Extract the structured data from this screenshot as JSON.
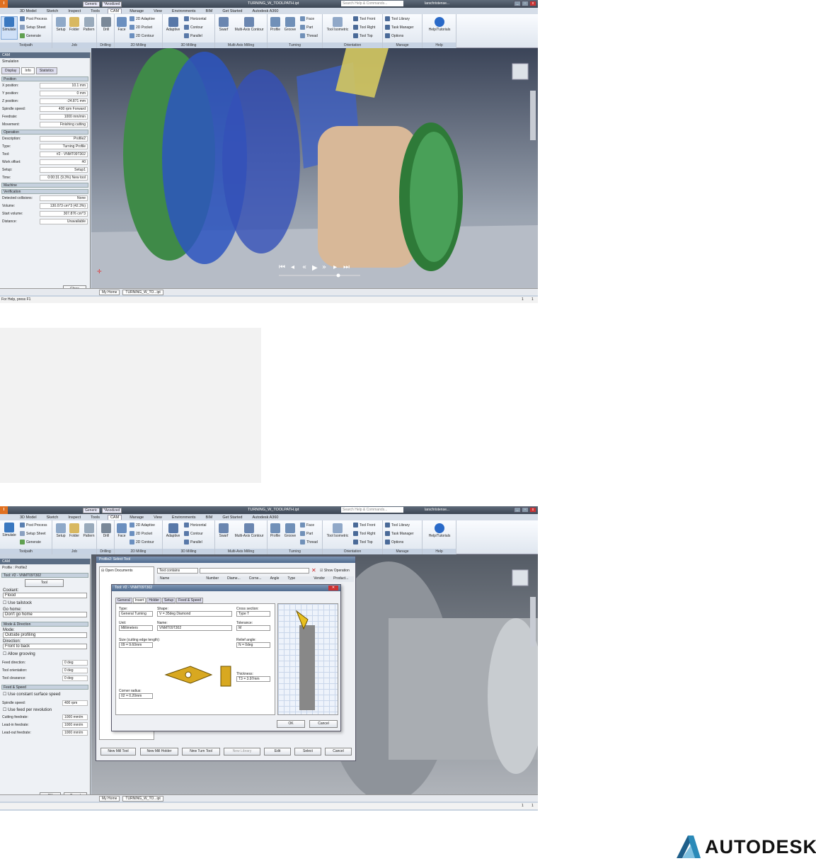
{
  "qat": {
    "app_letter": "I",
    "style_combo": "Generic",
    "material_combo": "*Anodized",
    "title": "TURNING_W_TOOLPATH.ipt",
    "search": "Search Help & Commands...",
    "user": "larschristense...",
    "win_min": "_",
    "win_max": "▫",
    "win_close": "x"
  },
  "tabs": [
    "3D Model",
    "Sketch",
    "Inspect",
    "Tools",
    "CAM",
    "Manage",
    "View",
    "Environments",
    "BIM",
    "Get Started",
    "Autodesk A360"
  ],
  "ribbon": {
    "toolpath": {
      "label": "Toolpath",
      "simulate": "Simulate",
      "post_process": "Post Process",
      "setup_sheet": "Setup Sheet",
      "generate": "Generate"
    },
    "job": {
      "label": "Job",
      "setup": "Setup",
      "folder": "Folder",
      "pattern": "Pattern"
    },
    "drilling": {
      "label": "Drilling",
      "drill": "Drill"
    },
    "milling2d": {
      "label": "2D Milling",
      "face": "Face",
      "adaptive": "2D Adaptive",
      "pocket": "2D Pocket",
      "contour": "2D Contour"
    },
    "milling3d": {
      "label": "3D Milling",
      "adaptive": "Adaptive",
      "horizontal": "Horizontal",
      "contour": "Contour",
      "parallel": "Parallel"
    },
    "multiaxis": {
      "label": "Multi-Axis Milling",
      "swarf": "Swarf",
      "contour": "Multi-Axis Contour"
    },
    "turning": {
      "label": "Turning",
      "profile": "Profile",
      "groove": "Groove",
      "face": "Face",
      "part": "Part",
      "thread": "Thread"
    },
    "orientation": {
      "label": "Orientation",
      "isometric": "Tool Isometric",
      "front": "Tool Front",
      "right": "Tool Right",
      "top": "Tool Top"
    },
    "manage": {
      "label": "Manage",
      "library": "Tool Library",
      "task": "Task Manager",
      "options": "Options"
    },
    "help": {
      "label": "Help",
      "tutorials": "Help/Tutorials"
    }
  },
  "panel1": {
    "header": "CAM",
    "subtitle": "Simulation",
    "tabs": [
      "Display",
      "Info",
      "Statistics"
    ],
    "position": {
      "title": "Position",
      "rows": [
        [
          "X position:",
          "10.1 mm"
        ],
        [
          "Y position:",
          "0 mm"
        ],
        [
          "Z position:",
          "-24.871 mm"
        ],
        [
          "Spindle speed:",
          "400 rpm Forward"
        ],
        [
          "Feedrate:",
          "1000 mm/min"
        ],
        [
          "Movement:",
          "Finishing cutting"
        ]
      ]
    },
    "operation": {
      "title": "Operation",
      "rows": [
        [
          "Description:",
          "Profile2"
        ],
        [
          "Type:",
          "Turning Profile"
        ],
        [
          "Tool:",
          "#2 - VNMT09T302"
        ],
        [
          "Work offset:",
          "#0"
        ],
        [
          "Setup:",
          "Setup1"
        ],
        [
          "Time:",
          "0:00:31 (9.3%) New tool"
        ]
      ]
    },
    "machine": {
      "title": "Machine"
    },
    "verification": {
      "title": "Verification",
      "rows": [
        [
          "Detected collisions:",
          "None"
        ],
        [
          "Volume:",
          "130.073 cm^3 (42.3%)"
        ],
        [
          "Start volume:",
          "307.876 cm^3"
        ],
        [
          "Distance:",
          "Unavailable"
        ]
      ]
    },
    "close": "Close"
  },
  "statusbar": {
    "home": "My Home",
    "doc": "TURNING_W_TO...ipt",
    "help": "For Help, press F1",
    "n1": "1",
    "n2": "1"
  },
  "panel2": {
    "header": "CAM",
    "subtitle": "Profile : Profile2",
    "tool_title": "Tool: #2 - VNMT09T302",
    "tool_btn": "Tool",
    "coolant_label": "Coolant:",
    "coolant": "Flood",
    "tailstock": "Use tailstock",
    "gohome_label": "Go home:",
    "gohome": "Don't go home",
    "mode_title": "Mode & Direction",
    "mode_label": "Mode:",
    "mode": "Outside profiling",
    "direction_label": "Direction:",
    "direction": "Front to back",
    "grooving": "Allow grooving",
    "feed_dir": [
      "Feed direction:",
      "0 deg"
    ],
    "tool_orient": [
      "Tool orientation:",
      "0 deg"
    ],
    "tool_clear": [
      "Tool clearance:",
      "0 deg"
    ],
    "feed_title": "Feed & Speed",
    "css": "Use constant surface speed",
    "spindle": [
      "Spindle speed:",
      "400 rpm"
    ],
    "feedrev": "Use feed per revolution",
    "cutting": [
      "Cutting feedrate:",
      "1000 mm/m"
    ],
    "leadin": [
      "Lead-in feedrate:",
      "1000 mm/m"
    ],
    "leadout": [
      "Lead-out feedrate:",
      "1000 mm/m"
    ],
    "ok": "OK",
    "cancel": "Cancel"
  },
  "select_tool": {
    "title": "Profile2: Select Tool",
    "tree_root": "Open Documents",
    "filter": "Text contains",
    "show_op": "Show Operation",
    "cols": [
      "Name",
      "Number",
      "Diame...",
      "Corne...",
      "Angle",
      "Type",
      "Vendor",
      "Product..."
    ],
    "buttons": [
      "New Mill Tool",
      "New Mill Holder",
      "New Turn Tool",
      "New Library",
      "Edit",
      "Select",
      "Cancel"
    ]
  },
  "tool_dlg": {
    "title": "Tool: #2 - VNMT09T302",
    "tabs": [
      "General",
      "Insert",
      "Holder",
      "Setup",
      "Feed & Speed"
    ],
    "type_label": "Type:",
    "type": "General Turning",
    "shape_label": "Shape:",
    "shape": "V = 35deg Diamond",
    "cross_label": "Cross section:",
    "cross": "Type T",
    "unit_label": "Unit:",
    "unit": "Millimeters",
    "name_label": "Name:",
    "name": "VNMT09T302",
    "tol_label": "Tolerance:",
    "tol": "M",
    "size_label": "Size (cutting edge length):",
    "size": "09 = 9.60mm",
    "relief_label": "Relief angle:",
    "relief": "N = 0deg",
    "thick_label": "Thickness:",
    "thick": "T3 = 3.97mm",
    "corner_label": "Corner radius:",
    "corner": "02 = 0.20mm",
    "ok": "OK",
    "cancel": "Cancel"
  },
  "brand": {
    "name": "AUTODESK",
    "mark": "®"
  }
}
